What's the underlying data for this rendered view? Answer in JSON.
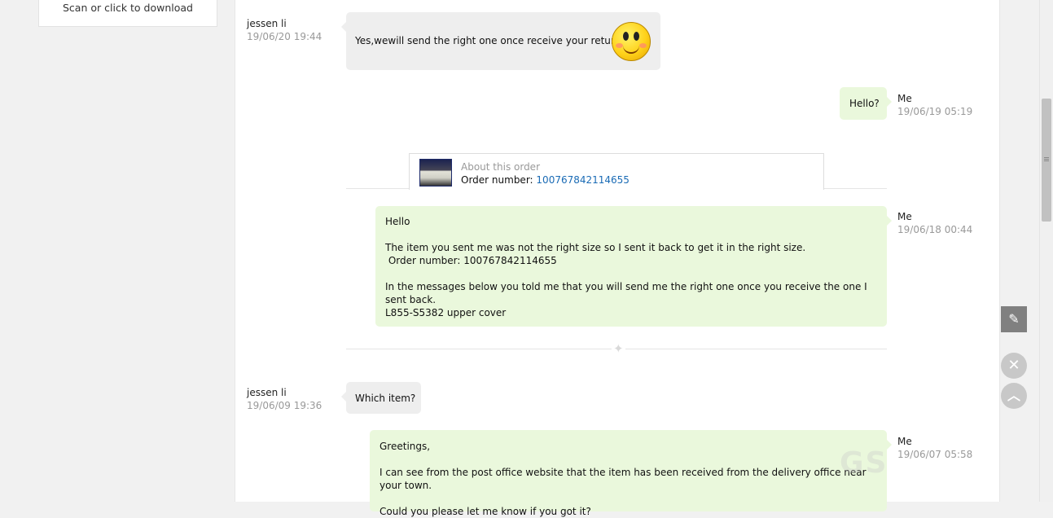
{
  "sidebar": {
    "download_text": "Scan or click to download"
  },
  "messages": [
    {
      "author": "jessen li",
      "time": "19/06/20 19:44",
      "text": "Yes,wewill send the right one once receive your returned",
      "emoji": "smiley-icon"
    },
    {
      "author": "Me",
      "time": "19/06/19 05:19",
      "text": "Hello?"
    },
    {
      "author": "Me",
      "time": "19/06/18 00:44",
      "text": "Hello\n\nThe item you sent me was not the right size so I sent it back to get it in the right size.\n Order number: 100767842114655\n\nIn the messages below you told me that you will send me the right one once you receive the one I sent back.\nL855-S5382 upper cover"
    },
    {
      "author": "jessen li",
      "time": "19/06/09 19:36",
      "text": "Which item?"
    },
    {
      "author": "Me",
      "time": "19/06/07 05:58",
      "text": "Greetings,\n\nI can see from the post office website that the item has been received from the delivery office near your town.\n\nCould you please let me know if you got it?"
    }
  ],
  "order": {
    "title": "About this order",
    "number_label": "Order number:",
    "number": "100767842114655"
  },
  "watermark": "GS"
}
